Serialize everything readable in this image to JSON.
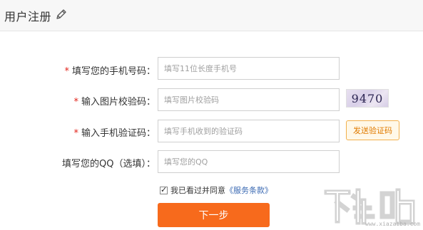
{
  "header": {
    "title": "用户注册",
    "edit_icon": "pencil-icon"
  },
  "form": {
    "phone": {
      "required_mark": "*",
      "label": "填写您的手机号码：",
      "placeholder": "填写11位长度手机号"
    },
    "captcha": {
      "required_mark": "*",
      "label": "输入图片校验码：",
      "placeholder": "填写图片校验码",
      "image_text": "9470"
    },
    "sms": {
      "required_mark": "*",
      "label": "输入手机验证码：",
      "placeholder": "填写手机收到的验证码",
      "send_button": "发送验证码"
    },
    "qq": {
      "label": "填写您的QQ（选填）：",
      "placeholder": "填写您的QQ"
    },
    "agreement": {
      "checked": true,
      "text": "我已看过并同意",
      "link": "《服务条款》"
    },
    "next_button": "下一步"
  },
  "watermark": {
    "logo_text": "下载吧",
    "url": "www.xiazaiba.com"
  },
  "colors": {
    "accent": "#f76a1c",
    "required": "#e2231a",
    "link": "#3b6ab3",
    "send_border": "#f2b04c"
  }
}
